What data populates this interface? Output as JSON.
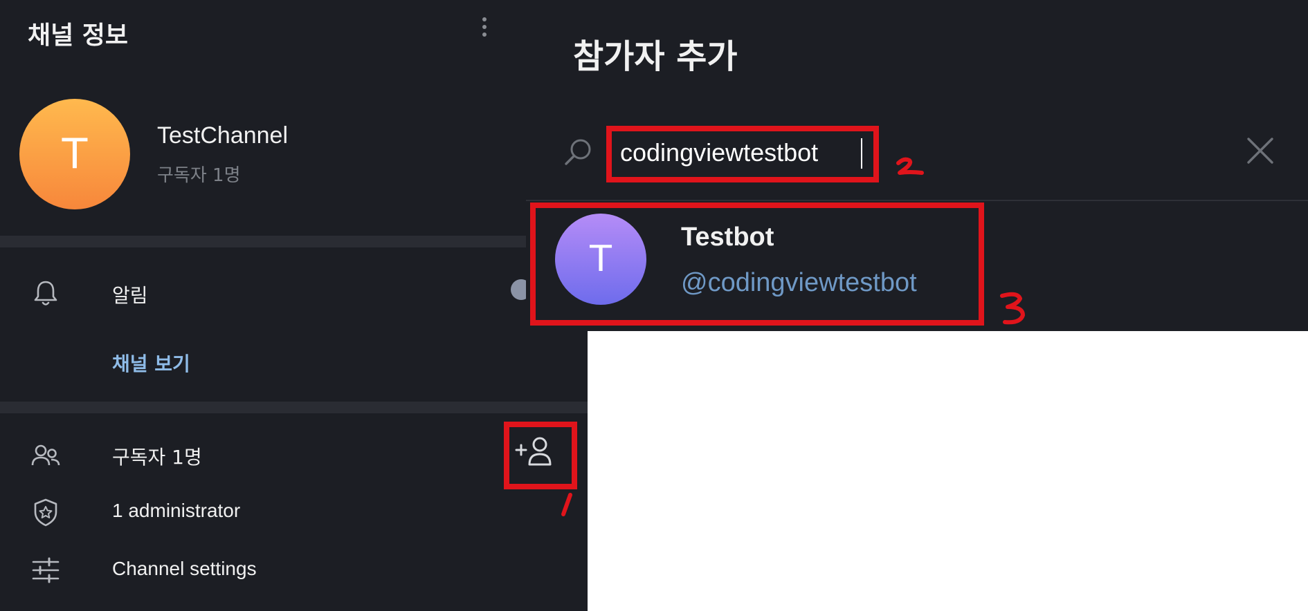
{
  "channel_info": {
    "title": "채널 정보",
    "more_icon": "more-vertical-icon",
    "avatar_letter": "T",
    "channel_name": "TestChannel",
    "subscriber_count_label": "구독자 1명",
    "notifications_label": "알림",
    "view_channel_label": "채널 보기",
    "subscribers_label": "구독자 1명",
    "administrators_label": "1 administrator",
    "settings_label": "Channel settings",
    "colors": {
      "panel_bg": "#1c1e24",
      "accent_link": "#8fbce8",
      "avatar_gradient": [
        "#ffb94e",
        "#f7873b"
      ]
    }
  },
  "add_members_dialog": {
    "title": "참가자 추가",
    "search_value": "codingviewtestbot",
    "result": {
      "avatar_letter": "T",
      "name": "Testbot",
      "username": "@codingviewtestbot",
      "avatar_gradient": [
        "#b58cf7",
        "#6e6cec"
      ]
    }
  },
  "annotations": {
    "color": "#e0141b",
    "step_1": "1",
    "step_2": "2",
    "step_3": "3"
  }
}
